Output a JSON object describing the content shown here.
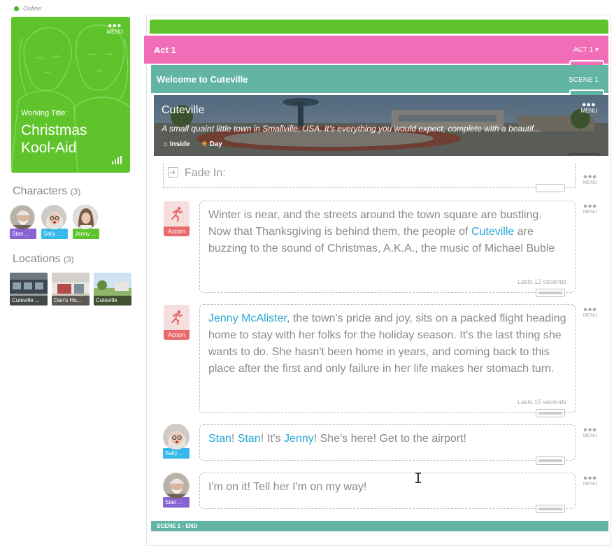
{
  "status": {
    "label": "Online",
    "color": "#4cb527"
  },
  "project": {
    "menu_label": "MENU",
    "working_title_label": "Working Title:",
    "title": "Christmas Kool-Aid",
    "stats_icon": "bar-chart-icon",
    "color": "#5fc42b"
  },
  "characters": {
    "heading": "Characters",
    "count": "(3)",
    "items": [
      {
        "name": "Stan ...",
        "color": "#8a63d2"
      },
      {
        "name": "Sally ...",
        "color": "#35b8ea"
      },
      {
        "name": "Jenny ...",
        "color": "#5fc42b"
      }
    ]
  },
  "locations": {
    "heading": "Locations",
    "count": "(3)",
    "items": [
      {
        "name": "Cuteville ..."
      },
      {
        "name": "Dan's Ho..."
      },
      {
        "name": "Cuteville"
      }
    ]
  },
  "act": {
    "label": "Act 1",
    "selector": "ACT 1 ▾",
    "color": "#f26db7"
  },
  "scene": {
    "title": "Welcome to Cuteville",
    "label": "SCENE 1",
    "end_label": "SCENE 1 - END",
    "color": "#62b5a4"
  },
  "location_header": {
    "name": "Cuteville",
    "description": "A small quaint little town in Smallville, USA. It's everything you would expect, complete with a beautif...",
    "setting": "Inside",
    "time": "Day",
    "menu_label": "MENU"
  },
  "fade_in": {
    "text": "Fade In:",
    "menu_label": "MENU"
  },
  "blocks": [
    {
      "type": "Action",
      "segments": [
        {
          "text": "Winter is near, and the streets around the town square are bustling. Now that Thanksgiving is behind them, the people of ",
          "hl": false
        },
        {
          "text": "Cuteville",
          "hl": true
        },
        {
          "text": " are buzzing to the sound of Christmas, A.K.A., the music of Michael Buble",
          "hl": false
        }
      ],
      "last_edit": "Lasts 12 seconds",
      "menu_label": "MENU"
    },
    {
      "type": "Action",
      "segments": [
        {
          "text": "Jenny McAlister",
          "hl": true
        },
        {
          "text": ", the town's pride and joy, sits on a packed flight heading home to stay with her folks for the holiday season. It's the last thing she wants to do. She hasn't been home in years, and coming back to this place after the first and only failure in her life makes her stomach turn.",
          "hl": false
        }
      ],
      "last_edit": "Lasts 15 seconds",
      "menu_label": "MENU"
    },
    {
      "type": "Dialogue",
      "speaker": "Sally ...",
      "speaker_color": "#35b8ea",
      "segments": [
        {
          "text": "Stan",
          "hl": true
        },
        {
          "text": "! ",
          "hl": false
        },
        {
          "text": "Stan",
          "hl": true
        },
        {
          "text": "! It's ",
          "hl": false
        },
        {
          "text": "Jenny",
          "hl": true
        },
        {
          "text": "! She's here! Get to the airport!",
          "hl": false
        }
      ],
      "menu_label": "MENU"
    },
    {
      "type": "Dialogue",
      "speaker": "Stan ...",
      "speaker_color": "#8a63d2",
      "segments": [
        {
          "text": "I'm on it! Tell her I'm on my way!",
          "hl": false
        }
      ],
      "menu_label": "MENU"
    }
  ]
}
